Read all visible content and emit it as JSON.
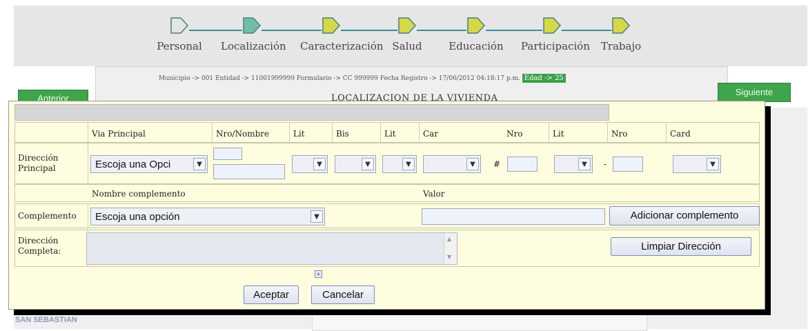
{
  "wizard": {
    "steps": [
      {
        "label": "Personal",
        "color": "#e4e4e4"
      },
      {
        "label": "Localización",
        "color": "#6fbfa6"
      },
      {
        "label": "Caracterización",
        "color": "#d4d84c"
      },
      {
        "label": "Salud",
        "color": "#d4d84c"
      },
      {
        "label": "Educación",
        "color": "#d4d84c"
      },
      {
        "label": "Participación",
        "color": "#d4d84c"
      },
      {
        "label": "Trabajo",
        "color": "#d4d84c"
      }
    ]
  },
  "background": {
    "prev_button": "Anterior",
    "next_button": "Siguiente",
    "breadcrumb": "Municipio -> 001 Entidad -> 11001999999 Formulario -> CC 999999 Fecha Registro -> 17/06/2012 04:18:17 p.m.",
    "edad": "Edad -> 25",
    "section_title": "LOCALIZACION DE LA VIVIENDA",
    "san_sebastian": "SAN SEBASTIAN"
  },
  "dialog": {
    "headers": {
      "via_principal": "Via Principal",
      "nro_nombre": "Nro/Nombre",
      "lit1": "Lit",
      "bis": "Bis",
      "lit2": "Lit",
      "car": "Car",
      "nro1": "Nro",
      "lit3": "Lit",
      "nro2": "Nro",
      "card": "Card"
    },
    "direccion_principal_label": "Dirección Principal",
    "via_select_value": "Escoja una Opci",
    "hash_symbol": "#",
    "dash_symbol": "-",
    "nombre_complemento_header": "Nombre complemento",
    "valor_header": "Valor",
    "complemento_label": "Complemento",
    "complemento_select_value": "Escoja una opción",
    "adicionar_button": "Adicionar complemento",
    "direccion_completa_label": "Dirección Completa:",
    "limpiar_button": "Limpiar Dirección",
    "aceptar_button": "Aceptar",
    "cancelar_button": "Cancelar"
  }
}
